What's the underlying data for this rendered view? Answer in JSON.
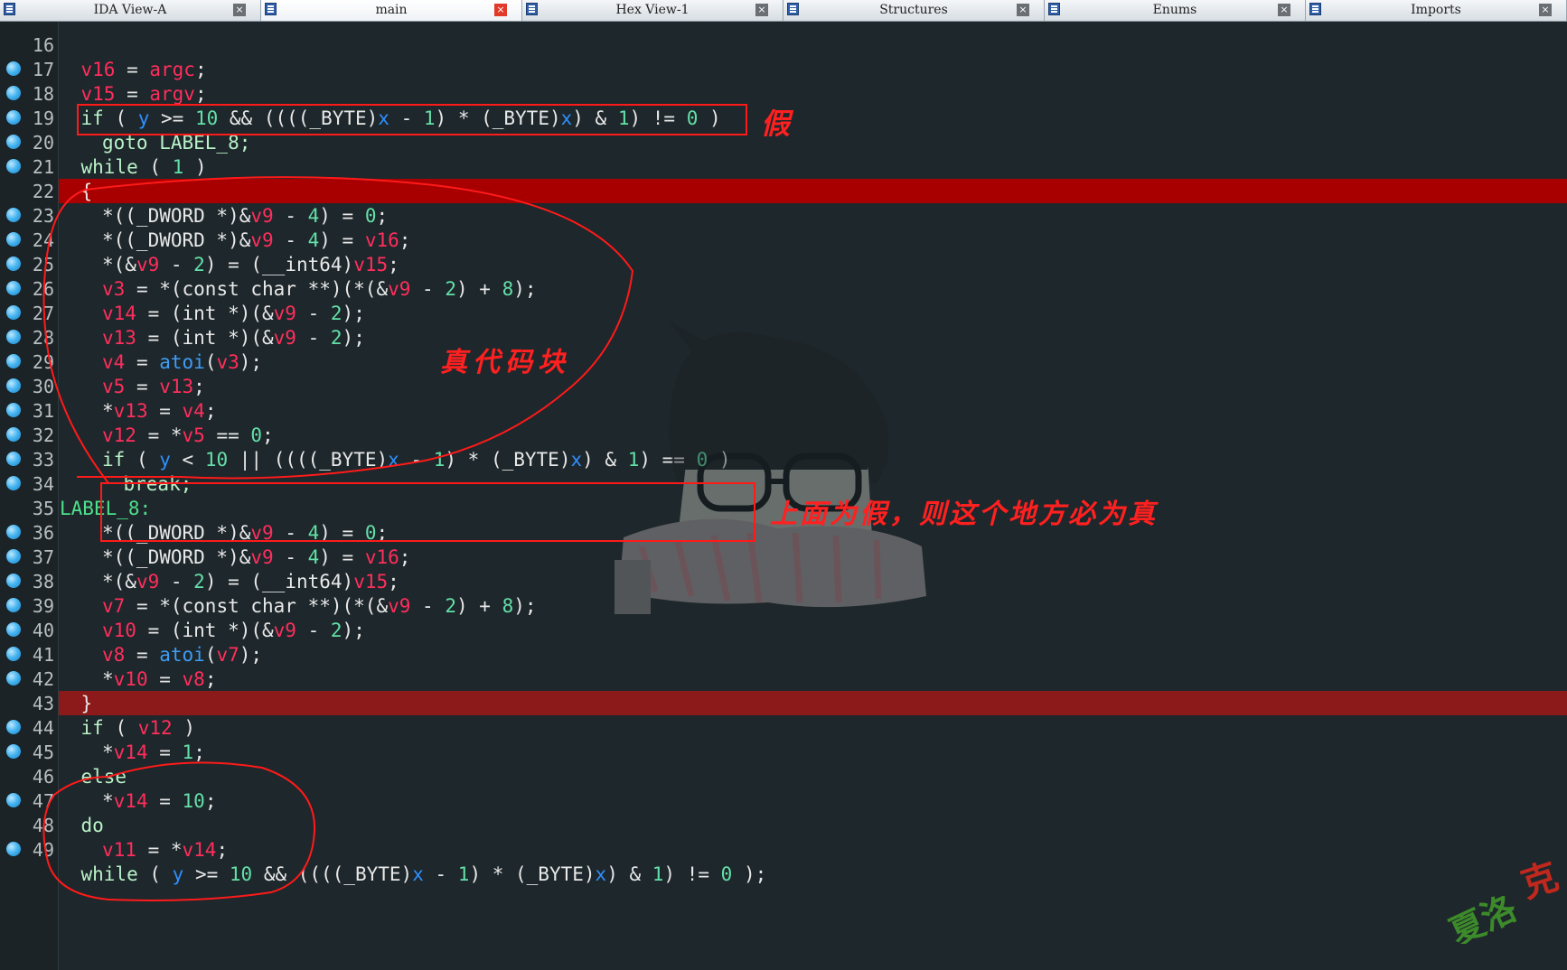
{
  "tabs": [
    {
      "label": "IDA View-A",
      "active": false
    },
    {
      "label": "main",
      "active": true
    },
    {
      "label": "Hex View-1",
      "active": false
    },
    {
      "label": "Structures",
      "active": false
    },
    {
      "label": "Enums",
      "active": false
    },
    {
      "label": "Imports",
      "active": false
    }
  ],
  "colors": {
    "background": "#1e272b",
    "keyword": "#b9f2c8",
    "variable": "#ff2e5c",
    "number": "#63e0a8",
    "global": "#2e8fff",
    "function": "#3e9df5",
    "label": "#4ee08a",
    "highlight_current": "#a80000",
    "highlight_secondary": "#8c1a1a",
    "annotation": "#ff1a1a",
    "breakpoint": "#3aaef0"
  },
  "code": {
    "lines": [
      {
        "n": "16",
        "bp": false,
        "indent": 0,
        "tokens": []
      },
      {
        "n": "17",
        "bp": true,
        "indent": 1,
        "tokens": [
          [
            "v16",
            "var"
          ],
          [
            " = ",
            "op"
          ],
          [
            "argc",
            "var"
          ],
          [
            ";",
            "op"
          ]
        ]
      },
      {
        "n": "18",
        "bp": true,
        "indent": 1,
        "tokens": [
          [
            "v15",
            "var"
          ],
          [
            " = ",
            "op"
          ],
          [
            "argv",
            "var"
          ],
          [
            ";",
            "op"
          ]
        ]
      },
      {
        "n": "19",
        "bp": true,
        "indent": 1,
        "tokens": [
          [
            "if",
            "kw"
          ],
          [
            " ( ",
            "op"
          ],
          [
            "y",
            "glob"
          ],
          [
            " >= ",
            "op"
          ],
          [
            "10",
            "num"
          ],
          [
            " && ((((_BYTE)",
            "op"
          ],
          [
            "x",
            "glob"
          ],
          [
            " - ",
            "op"
          ],
          [
            "1",
            "num"
          ],
          [
            ") * (_BYTE)",
            "op"
          ],
          [
            "x",
            "glob"
          ],
          [
            ") & ",
            "op"
          ],
          [
            "1",
            "num"
          ],
          [
            ") != ",
            "op"
          ],
          [
            "0",
            "num"
          ],
          [
            " )",
            "op"
          ]
        ]
      },
      {
        "n": "20",
        "bp": true,
        "indent": 2,
        "tokens": [
          [
            "goto LABEL_8;",
            "kw"
          ]
        ]
      },
      {
        "n": "21",
        "bp": true,
        "indent": 1,
        "tokens": [
          [
            "while",
            "kw"
          ],
          [
            " ( ",
            "op"
          ],
          [
            "1",
            "num"
          ],
          [
            " )",
            "op"
          ]
        ]
      },
      {
        "n": "22",
        "bp": false,
        "indent": 1,
        "tokens": [
          [
            "{",
            "op"
          ]
        ]
      },
      {
        "n": "23",
        "bp": true,
        "indent": 2,
        "tokens": [
          [
            "*((_DWORD *)&",
            "op"
          ],
          [
            "v9",
            "var"
          ],
          [
            " - ",
            "op"
          ],
          [
            "4",
            "num"
          ],
          [
            ") = ",
            "op"
          ],
          [
            "0",
            "num"
          ],
          [
            ";",
            "op"
          ]
        ]
      },
      {
        "n": "24",
        "bp": true,
        "indent": 2,
        "tokens": [
          [
            "*((_DWORD *)&",
            "op"
          ],
          [
            "v9",
            "var"
          ],
          [
            " - ",
            "op"
          ],
          [
            "4",
            "num"
          ],
          [
            ") = ",
            "op"
          ],
          [
            "v16",
            "var"
          ],
          [
            ";",
            "op"
          ]
        ]
      },
      {
        "n": "25",
        "bp": true,
        "indent": 2,
        "tokens": [
          [
            "*(&",
            "op"
          ],
          [
            "v9",
            "var"
          ],
          [
            " - ",
            "op"
          ],
          [
            "2",
            "num"
          ],
          [
            ") = (__int64)",
            "op"
          ],
          [
            "v15",
            "var"
          ],
          [
            ";",
            "op"
          ]
        ]
      },
      {
        "n": "26",
        "bp": true,
        "indent": 2,
        "tokens": [
          [
            "v3",
            "var"
          ],
          [
            " = *(const char **)(*(&",
            "op"
          ],
          [
            "v9",
            "var"
          ],
          [
            " - ",
            "op"
          ],
          [
            "2",
            "num"
          ],
          [
            ") + ",
            "op"
          ],
          [
            "8",
            "num"
          ],
          [
            ");",
            "op"
          ]
        ]
      },
      {
        "n": "27",
        "bp": true,
        "indent": 2,
        "tokens": [
          [
            "v14",
            "var"
          ],
          [
            " = (int *)(&",
            "op"
          ],
          [
            "v9",
            "var"
          ],
          [
            " - ",
            "op"
          ],
          [
            "2",
            "num"
          ],
          [
            ");",
            "op"
          ]
        ]
      },
      {
        "n": "28",
        "bp": true,
        "indent": 2,
        "tokens": [
          [
            "v13",
            "var"
          ],
          [
            " = (int *)(&",
            "op"
          ],
          [
            "v9",
            "var"
          ],
          [
            " - ",
            "op"
          ],
          [
            "2",
            "num"
          ],
          [
            ");",
            "op"
          ]
        ]
      },
      {
        "n": "29",
        "bp": true,
        "indent": 2,
        "tokens": [
          [
            "v4",
            "var"
          ],
          [
            " = ",
            "op"
          ],
          [
            "atoi",
            "fn"
          ],
          [
            "(",
            "op"
          ],
          [
            "v3",
            "var"
          ],
          [
            ");",
            "op"
          ]
        ]
      },
      {
        "n": "30",
        "bp": true,
        "indent": 2,
        "tokens": [
          [
            "v5",
            "var"
          ],
          [
            " = ",
            "op"
          ],
          [
            "v13",
            "var"
          ],
          [
            ";",
            "op"
          ]
        ]
      },
      {
        "n": "31",
        "bp": true,
        "indent": 2,
        "tokens": [
          [
            "*",
            "op"
          ],
          [
            "v13",
            "var"
          ],
          [
            " = ",
            "op"
          ],
          [
            "v4",
            "var"
          ],
          [
            ";",
            "op"
          ]
        ]
      },
      {
        "n": "32",
        "bp": true,
        "indent": 2,
        "tokens": [
          [
            "v12",
            "var"
          ],
          [
            " = *",
            "op"
          ],
          [
            "v5",
            "var"
          ],
          [
            " == ",
            "op"
          ],
          [
            "0",
            "num"
          ],
          [
            ";",
            "op"
          ]
        ]
      },
      {
        "n": "33",
        "bp": true,
        "indent": 2,
        "tokens": [
          [
            "if",
            "kw"
          ],
          [
            " ( ",
            "op"
          ],
          [
            "y",
            "glob"
          ],
          [
            " < ",
            "op"
          ],
          [
            "10",
            "num"
          ],
          [
            " || ((((_BYTE)",
            "op"
          ],
          [
            "x",
            "glob"
          ],
          [
            " - ",
            "op"
          ],
          [
            "1",
            "num"
          ],
          [
            ") * (_BYTE)",
            "op"
          ],
          [
            "x",
            "glob"
          ],
          [
            ") & ",
            "op"
          ],
          [
            "1",
            "num"
          ],
          [
            ") == ",
            "op"
          ],
          [
            "0",
            "num"
          ],
          [
            " )",
            "op"
          ]
        ]
      },
      {
        "n": "34",
        "bp": true,
        "indent": 3,
        "tokens": [
          [
            "break;",
            "kw"
          ]
        ]
      },
      {
        "n": "35",
        "bp": false,
        "indent": 0,
        "tokens": [
          [
            "LABEL_8:",
            "lbl"
          ]
        ]
      },
      {
        "n": "36",
        "bp": true,
        "indent": 2,
        "tokens": [
          [
            "*((_DWORD *)&",
            "op"
          ],
          [
            "v9",
            "var"
          ],
          [
            " - ",
            "op"
          ],
          [
            "4",
            "num"
          ],
          [
            ") = ",
            "op"
          ],
          [
            "0",
            "num"
          ],
          [
            ";",
            "op"
          ]
        ]
      },
      {
        "n": "37",
        "bp": true,
        "indent": 2,
        "tokens": [
          [
            "*((_DWORD *)&",
            "op"
          ],
          [
            "v9",
            "var"
          ],
          [
            " - ",
            "op"
          ],
          [
            "4",
            "num"
          ],
          [
            ") = ",
            "op"
          ],
          [
            "v16",
            "var"
          ],
          [
            ";",
            "op"
          ]
        ]
      },
      {
        "n": "38",
        "bp": true,
        "indent": 2,
        "tokens": [
          [
            "*(&",
            "op"
          ],
          [
            "v9",
            "var"
          ],
          [
            " - ",
            "op"
          ],
          [
            "2",
            "num"
          ],
          [
            ") = (__int64)",
            "op"
          ],
          [
            "v15",
            "var"
          ],
          [
            ";",
            "op"
          ]
        ]
      },
      {
        "n": "39",
        "bp": true,
        "indent": 2,
        "tokens": [
          [
            "v7",
            "var"
          ],
          [
            " = *(const char **)(*(&",
            "op"
          ],
          [
            "v9",
            "var"
          ],
          [
            " - ",
            "op"
          ],
          [
            "2",
            "num"
          ],
          [
            ") + ",
            "op"
          ],
          [
            "8",
            "num"
          ],
          [
            ");",
            "op"
          ]
        ]
      },
      {
        "n": "40",
        "bp": true,
        "indent": 2,
        "tokens": [
          [
            "v10",
            "var"
          ],
          [
            " = (int *)(&",
            "op"
          ],
          [
            "v9",
            "var"
          ],
          [
            " - ",
            "op"
          ],
          [
            "2",
            "num"
          ],
          [
            ");",
            "op"
          ]
        ]
      },
      {
        "n": "41",
        "bp": true,
        "indent": 2,
        "tokens": [
          [
            "v8",
            "var"
          ],
          [
            " = ",
            "op"
          ],
          [
            "atoi",
            "fn"
          ],
          [
            "(",
            "op"
          ],
          [
            "v7",
            "var"
          ],
          [
            ");",
            "op"
          ]
        ]
      },
      {
        "n": "42",
        "bp": true,
        "indent": 2,
        "tokens": [
          [
            "*",
            "op"
          ],
          [
            "v10",
            "var"
          ],
          [
            " = ",
            "op"
          ],
          [
            "v8",
            "var"
          ],
          [
            ";",
            "op"
          ]
        ]
      },
      {
        "n": "43",
        "bp": false,
        "indent": 1,
        "tokens": [
          [
            "}",
            "op"
          ]
        ]
      },
      {
        "n": "44",
        "bp": true,
        "indent": 1,
        "tokens": [
          [
            "if",
            "kw"
          ],
          [
            " ( ",
            "op"
          ],
          [
            "v12",
            "var"
          ],
          [
            " )",
            "op"
          ]
        ]
      },
      {
        "n": "45",
        "bp": true,
        "indent": 2,
        "tokens": [
          [
            "*",
            "op"
          ],
          [
            "v14",
            "var"
          ],
          [
            " = ",
            "op"
          ],
          [
            "1",
            "num"
          ],
          [
            ";",
            "op"
          ]
        ]
      },
      {
        "n": "46",
        "bp": false,
        "indent": 1,
        "tokens": [
          [
            "else",
            "kw"
          ]
        ]
      },
      {
        "n": "47",
        "bp": true,
        "indent": 2,
        "tokens": [
          [
            "*",
            "op"
          ],
          [
            "v14",
            "var"
          ],
          [
            " = ",
            "op"
          ],
          [
            "10",
            "num"
          ],
          [
            ";",
            "op"
          ]
        ]
      },
      {
        "n": "48",
        "bp": false,
        "indent": 1,
        "tokens": [
          [
            "do",
            "kw"
          ]
        ]
      },
      {
        "n": "49",
        "bp": true,
        "indent": 2,
        "tokens": [
          [
            "v11",
            "var"
          ],
          [
            " = *",
            "op"
          ],
          [
            "v14",
            "var"
          ],
          [
            ";",
            "op"
          ]
        ]
      },
      {
        "n": "",
        "bp": false,
        "indent": 1,
        "tokens": [
          [
            "while",
            "kw"
          ],
          [
            " ( ",
            "op"
          ],
          [
            "y",
            "glob"
          ],
          [
            " >= ",
            "op"
          ],
          [
            "10",
            "num"
          ],
          [
            " && ((((_BYTE)",
            "op"
          ],
          [
            "x",
            "glob"
          ],
          [
            " - ",
            "op"
          ],
          [
            "1",
            "num"
          ],
          [
            ") * (_BYTE)",
            "op"
          ],
          [
            "x",
            "glob"
          ],
          [
            ") & ",
            "op"
          ],
          [
            "1",
            "num"
          ],
          [
            ") != ",
            "op"
          ],
          [
            "0",
            "num"
          ],
          [
            " );",
            "op"
          ]
        ]
      }
    ],
    "highlighted_lines": [
      {
        "n": "22",
        "style": "current"
      },
      {
        "n": "43",
        "style": "secondary"
      }
    ]
  },
  "annotations": {
    "false_label": "假",
    "true_block_label": "真代码块",
    "then_true_label": "上面为假，则这个地方必为真"
  },
  "watermark": {
    "icon": "anime-boy-with-glasses-icon"
  },
  "logo": {
    "text": "夏洛克",
    "icon": "signature-logo-icon"
  }
}
